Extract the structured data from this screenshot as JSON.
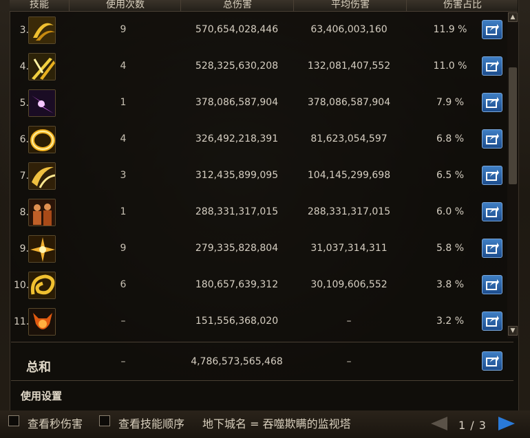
{
  "header": {
    "col_skill": "技能",
    "col_uses": "使用次数",
    "col_total": "总伤害",
    "col_avg": "平均伤害",
    "col_pct": "伤害占比"
  },
  "rows": [
    {
      "rank": "3.",
      "uses": "9",
      "total": "570,654,028,446",
      "avg": "63,406,003,160",
      "pct": "11.9 %",
      "icon": "crescent-slash-icon"
    },
    {
      "rank": "4.",
      "uses": "4",
      "total": "528,325,630,208",
      "avg": "132,081,407,552",
      "pct": "11.0 %",
      "icon": "crossed-swords-icon"
    },
    {
      "rank": "5.",
      "uses": "1",
      "total": "378,086,587,904",
      "avg": "378,086,587,904",
      "pct": "7.9 %",
      "icon": "purple-lightning-icon"
    },
    {
      "rank": "6.",
      "uses": "4",
      "total": "326,492,218,391",
      "avg": "81,623,054,597",
      "pct": "6.8 %",
      "icon": "golden-ring-icon"
    },
    {
      "rank": "7.",
      "uses": "3",
      "total": "312,435,899,095",
      "avg": "104,145,299,698",
      "pct": "6.5 %",
      "icon": "wind-slash-icon"
    },
    {
      "rank": "8.",
      "uses": "1",
      "total": "288,331,317,015",
      "avg": "288,331,317,015",
      "pct": "6.0 %",
      "icon": "warriors-icon"
    },
    {
      "rank": "9.",
      "uses": "9",
      "total": "279,335,828,804",
      "avg": "31,037,314,311",
      "pct": "5.8 %",
      "icon": "spark-burst-icon"
    },
    {
      "rank": "10.",
      "uses": "6",
      "total": "180,657,639,312",
      "avg": "30,109,606,552",
      "pct": "3.8 %",
      "icon": "golden-vortex-icon"
    },
    {
      "rank": "11.",
      "uses": "–",
      "total": "151,556,368,020",
      "avg": "–",
      "pct": "3.2 %",
      "icon": "demon-emblem-icon"
    }
  ],
  "summary": {
    "label": "总和",
    "uses": "–",
    "total": "4,786,573,565,468",
    "avg": "–"
  },
  "settings_label": "使用设置",
  "bottom": {
    "option1": "查看秒伤害",
    "option2": "查看技能顺序",
    "dungeon": "地下城名 = 吞噬欺瞒的监视塔",
    "page": "1 / 3"
  },
  "colors": {
    "accent_blue": "#2a63a8",
    "gold": "#e8b020",
    "text": "#d6cfc2"
  }
}
